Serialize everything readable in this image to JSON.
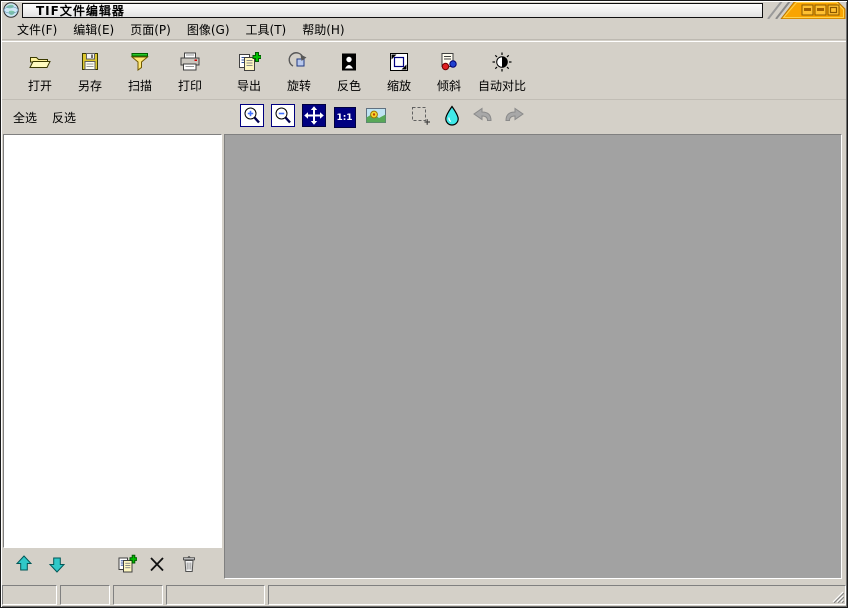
{
  "window": {
    "title": "TIF文件编辑器",
    "controls": {
      "buttons": [
        "minimize-button",
        "maximize-button",
        "close-button"
      ]
    }
  },
  "menu": {
    "items": [
      {
        "label": "文件(F)"
      },
      {
        "label": "编辑(E)"
      },
      {
        "label": "页面(P)"
      },
      {
        "label": "图像(G)"
      },
      {
        "label": "工具(T)"
      },
      {
        "label": "帮助(H)"
      }
    ]
  },
  "toolbar": {
    "buttons": [
      {
        "label": "打开",
        "icon": "open-folder-icon"
      },
      {
        "label": "另存",
        "icon": "floppy-save-icon"
      },
      {
        "label": "扫描",
        "icon": "scanner-funnel-icon"
      },
      {
        "label": "打印",
        "icon": "printer-icon"
      },
      {
        "label": "导出",
        "icon": "export-copy-plus-icon"
      },
      {
        "label": "旋转",
        "icon": "rotate-icon"
      },
      {
        "label": "反色",
        "icon": "invert-colors-icon"
      },
      {
        "label": "缩放",
        "icon": "scale-resize-icon"
      },
      {
        "label": "倾斜",
        "icon": "deskew-icon"
      },
      {
        "label": "自动对比",
        "icon": "auto-contrast-icon"
      }
    ]
  },
  "page_select_bar": {
    "select_all": "全选",
    "invert_selection": "反选"
  },
  "view_toolbar": {
    "buttons": [
      {
        "icon": "zoom-in-icon",
        "enabled": true
      },
      {
        "icon": "zoom-out-icon",
        "enabled": true
      },
      {
        "icon": "fit-window-icon",
        "enabled": true
      },
      {
        "icon": "actual-size-icon",
        "label": "1:1",
        "enabled": true
      },
      {
        "icon": "photo-icon",
        "enabled": true
      },
      {
        "icon": "select-region-icon",
        "enabled": true
      },
      {
        "icon": "color-drop-icon",
        "enabled": true
      },
      {
        "icon": "undo-icon",
        "enabled": false
      },
      {
        "icon": "redo-icon",
        "enabled": false
      }
    ]
  },
  "thumbnail_panel": {
    "items": []
  },
  "page_actions": {
    "buttons": [
      {
        "icon": "move-up-icon"
      },
      {
        "icon": "move-down-icon"
      },
      {
        "icon": "paste-add-icon"
      },
      {
        "icon": "delete-x-icon"
      },
      {
        "icon": "trash-icon"
      }
    ]
  },
  "status_bar": {
    "panels": [
      "",
      "",
      "",
      "",
      ""
    ]
  },
  "colors": {
    "window_chrome": "#d4d0c8",
    "canvas_background": "#a2a2a2",
    "titlebar_accent_orange": "#f9a400",
    "control_button_orange": "#ffc030",
    "accent_navy": "#000080",
    "action_teal": "#30c8c8",
    "add_green": "#00c000"
  }
}
